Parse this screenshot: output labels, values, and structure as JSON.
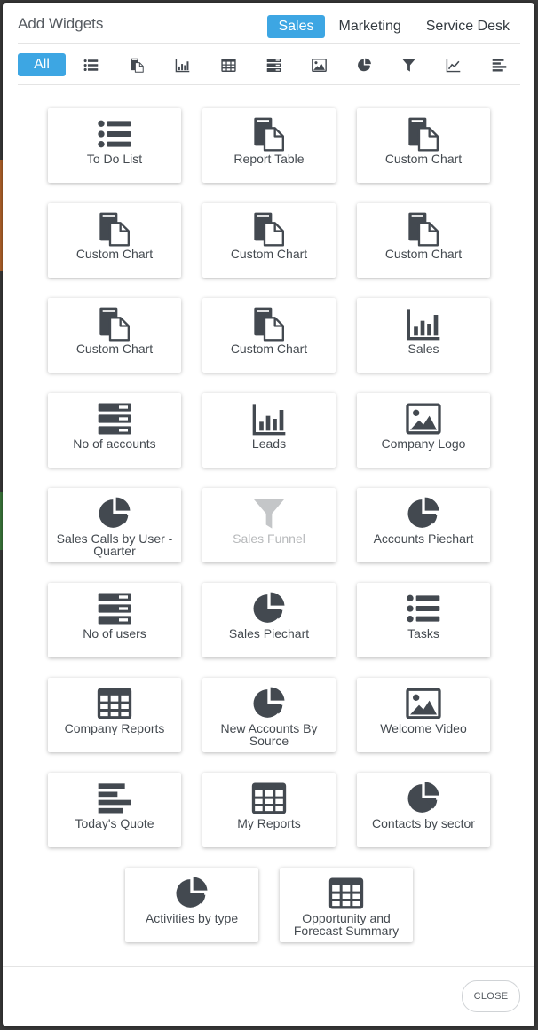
{
  "header": {
    "title": "Add Widgets",
    "modes": [
      {
        "label": "Sales",
        "active": true
      },
      {
        "label": "Marketing",
        "active": false
      },
      {
        "label": "Service Desk",
        "active": false
      }
    ]
  },
  "filters": {
    "all_label": "All",
    "icons": [
      "list-icon",
      "report-icon",
      "bar-chart-icon",
      "table-icon",
      "stack-icon",
      "image-icon",
      "pie-icon",
      "funnel-icon",
      "line-chart-icon",
      "text-lines-icon"
    ]
  },
  "widgets": [
    {
      "label": "To Do List",
      "icon": "list-icon"
    },
    {
      "label": "Report Table",
      "icon": "report-icon"
    },
    {
      "label": "Custom Chart",
      "icon": "report-icon"
    },
    {
      "label": "Custom Chart",
      "icon": "report-icon"
    },
    {
      "label": "Custom Chart",
      "icon": "report-icon"
    },
    {
      "label": "Custom Chart",
      "icon": "report-icon"
    },
    {
      "label": "Custom Chart",
      "icon": "report-icon"
    },
    {
      "label": "Custom Chart",
      "icon": "report-icon"
    },
    {
      "label": "Sales",
      "icon": "bar-chart-icon"
    },
    {
      "label": "No of accounts",
      "icon": "stack-icon"
    },
    {
      "label": "Leads",
      "icon": "bar-chart-icon"
    },
    {
      "label": "Company Logo",
      "icon": "image-icon"
    },
    {
      "label": "Sales Calls by User - Quarter",
      "icon": "pie-icon"
    },
    {
      "label": "Sales Funnel",
      "icon": "funnel-icon",
      "disabled": true
    },
    {
      "label": "Accounts Piechart",
      "icon": "pie-icon"
    },
    {
      "label": "No of users",
      "icon": "stack-icon"
    },
    {
      "label": "Sales Piechart",
      "icon": "pie-icon"
    },
    {
      "label": "Tasks",
      "icon": "list-icon"
    },
    {
      "label": "Company Reports",
      "icon": "table-icon"
    },
    {
      "label": "New Accounts By Source",
      "icon": "pie-icon"
    },
    {
      "label": "Welcome Video",
      "icon": "image-icon"
    },
    {
      "label": "Today's Quote",
      "icon": "text-lines-icon"
    },
    {
      "label": "My Reports",
      "icon": "table-icon"
    },
    {
      "label": "Contacts by sector",
      "icon": "pie-icon"
    },
    {
      "label": "Activities by type",
      "icon": "pie-icon"
    },
    {
      "label": "Opportunity and Forecast Summary",
      "icon": "table-icon"
    }
  ],
  "footer": {
    "close_label": "CLOSE"
  },
  "colors": {
    "accent": "#3da6e3",
    "icon": "#434950",
    "icon_disabled": "#c4c6c8"
  }
}
